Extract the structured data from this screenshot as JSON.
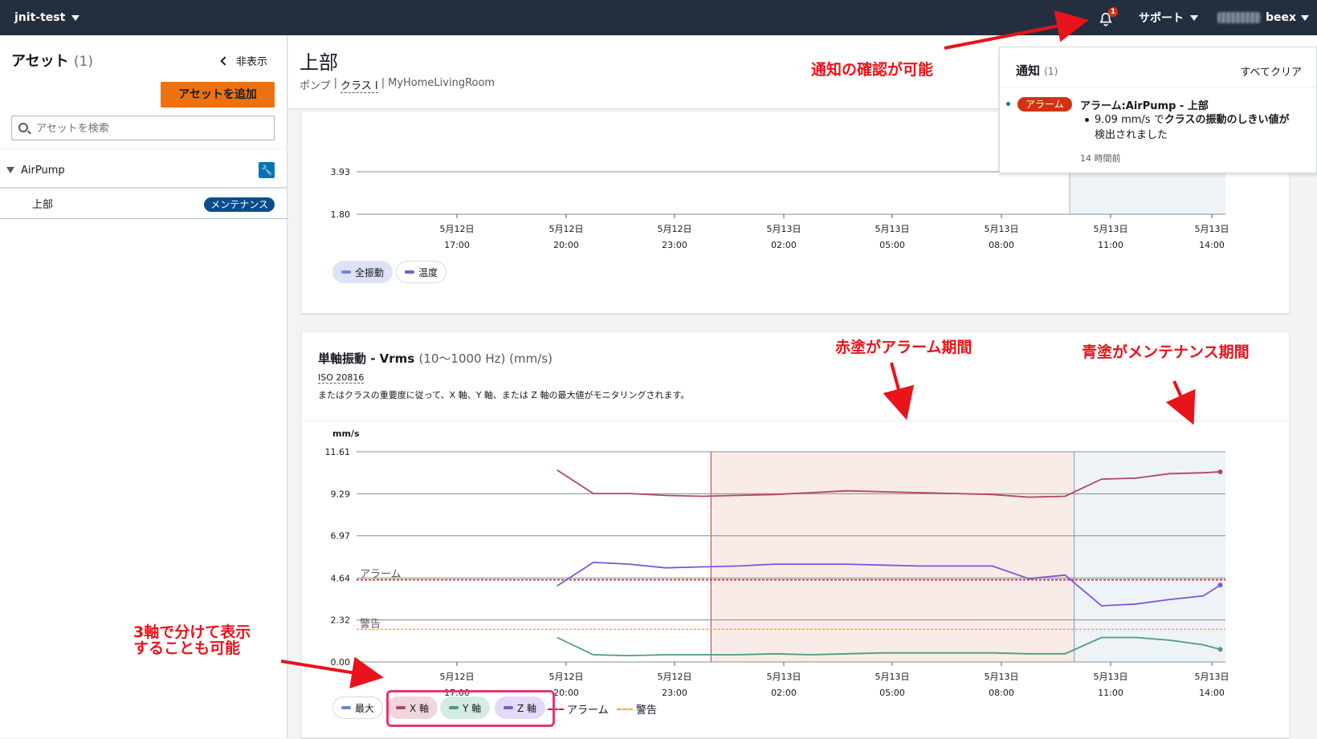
{
  "topbar": {
    "project": "jnit-test",
    "notification_count": "1",
    "support": "サポート",
    "user_suffix": "beex"
  },
  "sidebar": {
    "title": "アセット",
    "count": "(1)",
    "hide": "非表示",
    "add_button": "アセットを追加",
    "search_placeholder": "アセットを検索",
    "tree": [
      {
        "label": "AirPump"
      },
      {
        "label": "上部",
        "badge": "メンテナンス"
      }
    ]
  },
  "page": {
    "title": "上部",
    "breadcrumb": [
      "ポンプ",
      "|",
      "クラス I",
      "|",
      "MyHomeLivingRoom"
    ]
  },
  "notifications": {
    "title": "通知",
    "count": "(1)",
    "clear": "すべてクリア",
    "badge": "アラーム",
    "item_title": "アラーム:AirPump - 上部",
    "item_body_value": "9.09 mm/s で",
    "item_body_rest": "クラスの振動のしきい値が",
    "item_body_line2": "検出されました",
    "time": "14 時間前"
  },
  "chart1": {
    "legend": [
      "全振動",
      "温度"
    ]
  },
  "chart2": {
    "title": "単軸振動 - Vrms",
    "unit": "(10〜1000 Hz) (mm/s)",
    "standard": "ISO 20816",
    "description": "またはクラスの重要度に従って、X 軸、Y 軸、または Z 軸の最大値がモニタリングされます。",
    "legend": [
      "最大",
      "X 軸",
      "Y 軸",
      "Z 軸",
      "アラーム",
      "警告"
    ]
  },
  "annotations": {
    "notif": "通知の確認が可能",
    "red": "赤塗がアラーム期間",
    "blue": "青塗がメンテナンス期間",
    "axis3_l1": "3軸で分けて表示",
    "axis3_l2": "することも可能"
  },
  "colors": {
    "x_axis": "#b0475e",
    "y_axis": "#4e9a82",
    "z_axis": "#7f56d9",
    "alarm": "#c21f1f",
    "warning": "#f2b01e",
    "max": "#6887d6",
    "temp": "#7c5bc7"
  },
  "chart_data": [
    {
      "type": "line",
      "y_ticks": [
        "3.93",
        "1.80"
      ],
      "x_ticks": [
        "5月12日\n17:00",
        "5月12日\n20:00",
        "5月12日\n23:00",
        "5月13日\n02:00",
        "5月13日\n05:00",
        "5月13日\n08:00",
        "5月13日\n11:00",
        "5月13日\n14:00"
      ],
      "legend": [
        "全振動",
        "温度"
      ],
      "grid": true,
      "shaded_regions": [
        {
          "type": "maintenance",
          "start": "5月13日 11:00",
          "end": "5月13日 14:00"
        }
      ]
    },
    {
      "type": "line",
      "ylabel": "mm/s",
      "ylim": [
        0,
        11.61
      ],
      "y_ticks": [
        "11.61",
        "9.29",
        "6.97",
        "4.64",
        "2.32",
        "0.00"
      ],
      "x_ticks": [
        "5月12日\n17:00",
        "5月12日\n20:00",
        "5月12日\n23:00",
        "5月13日\n02:00",
        "5月13日\n05:00",
        "5月13日\n08:00",
        "5月13日\n11:00",
        "5月13日\n14:00"
      ],
      "grid": true,
      "thresholds": [
        {
          "name": "アラーム",
          "value": 4.54
        },
        {
          "name": "警告",
          "value": 1.8
        }
      ],
      "shaded_regions": [
        {
          "type": "alarm",
          "start": "5月13日 00:00",
          "end": "5月13日 10:00"
        },
        {
          "type": "maintenance",
          "start": "5月13日 10:00",
          "end": "5月13日 14:00"
        }
      ],
      "series": [
        {
          "name": "X 軸",
          "x": [
            "5月12日 19:45",
            "5月12日 20:45",
            "5月12日 21:45",
            "5月12日 22:45",
            "5月12日 23:45",
            "5月13日 00:45",
            "5月13日 01:45",
            "5月13日 02:45",
            "5月13日 03:45",
            "5月13日 04:45",
            "5月13日 05:45",
            "5月13日 06:45",
            "5月13日 07:45",
            "5月13日 08:45",
            "5月13日 09:45",
            "5月13日 10:45",
            "5月13日 11:45",
            "5月13日 12:45",
            "5月13日 13:45",
            "5月13日 14:15"
          ],
          "y": [
            10.6,
            9.3,
            9.3,
            9.2,
            9.15,
            9.2,
            9.25,
            9.35,
            9.45,
            9.4,
            9.35,
            9.3,
            9.25,
            9.1,
            9.15,
            10.1,
            10.15,
            10.4,
            10.45,
            10.5
          ]
        },
        {
          "name": "Y 軸",
          "x": [
            "5月12日 19:45",
            "5月12日 20:45",
            "5月12日 21:45",
            "5月12日 22:45",
            "5月12日 23:45",
            "5月13日 00:45",
            "5月13日 01:45",
            "5月13日 02:45",
            "5月13日 03:45",
            "5月13日 04:45",
            "5月13日 05:45",
            "5月13日 06:45",
            "5月13日 07:45",
            "5月13日 08:45",
            "5月13日 09:45",
            "5月13日 10:45",
            "5月13日 11:45",
            "5月13日 12:45",
            "5月13日 13:45",
            "5月13日 14:15"
          ],
          "y": [
            1.35,
            0.4,
            0.35,
            0.4,
            0.4,
            0.4,
            0.45,
            0.4,
            0.45,
            0.5,
            0.5,
            0.5,
            0.5,
            0.45,
            0.45,
            1.35,
            1.35,
            1.2,
            0.95,
            0.7
          ]
        },
        {
          "name": "Z 軸",
          "x": [
            "5月12日 19:45",
            "5月12日 20:45",
            "5月12日 21:45",
            "5月12日 22:45",
            "5月12日 23:45",
            "5月13日 00:45",
            "5月13日 01:45",
            "5月13日 02:45",
            "5月13日 03:45",
            "5月13日 04:45",
            "5月13日 05:45",
            "5月13日 06:45",
            "5月13日 07:45",
            "5月13日 08:45",
            "5月13日 09:45",
            "5月13日 10:45",
            "5月13日 11:45",
            "5月13日 12:45",
            "5月13日 13:45",
            "5月13日 14:15"
          ],
          "y": [
            4.2,
            5.5,
            5.4,
            5.2,
            5.25,
            5.3,
            5.4,
            5.4,
            5.4,
            5.35,
            5.3,
            5.3,
            5.3,
            4.6,
            4.8,
            3.1,
            3.2,
            3.45,
            3.65,
            4.25
          ]
        }
      ]
    }
  ]
}
